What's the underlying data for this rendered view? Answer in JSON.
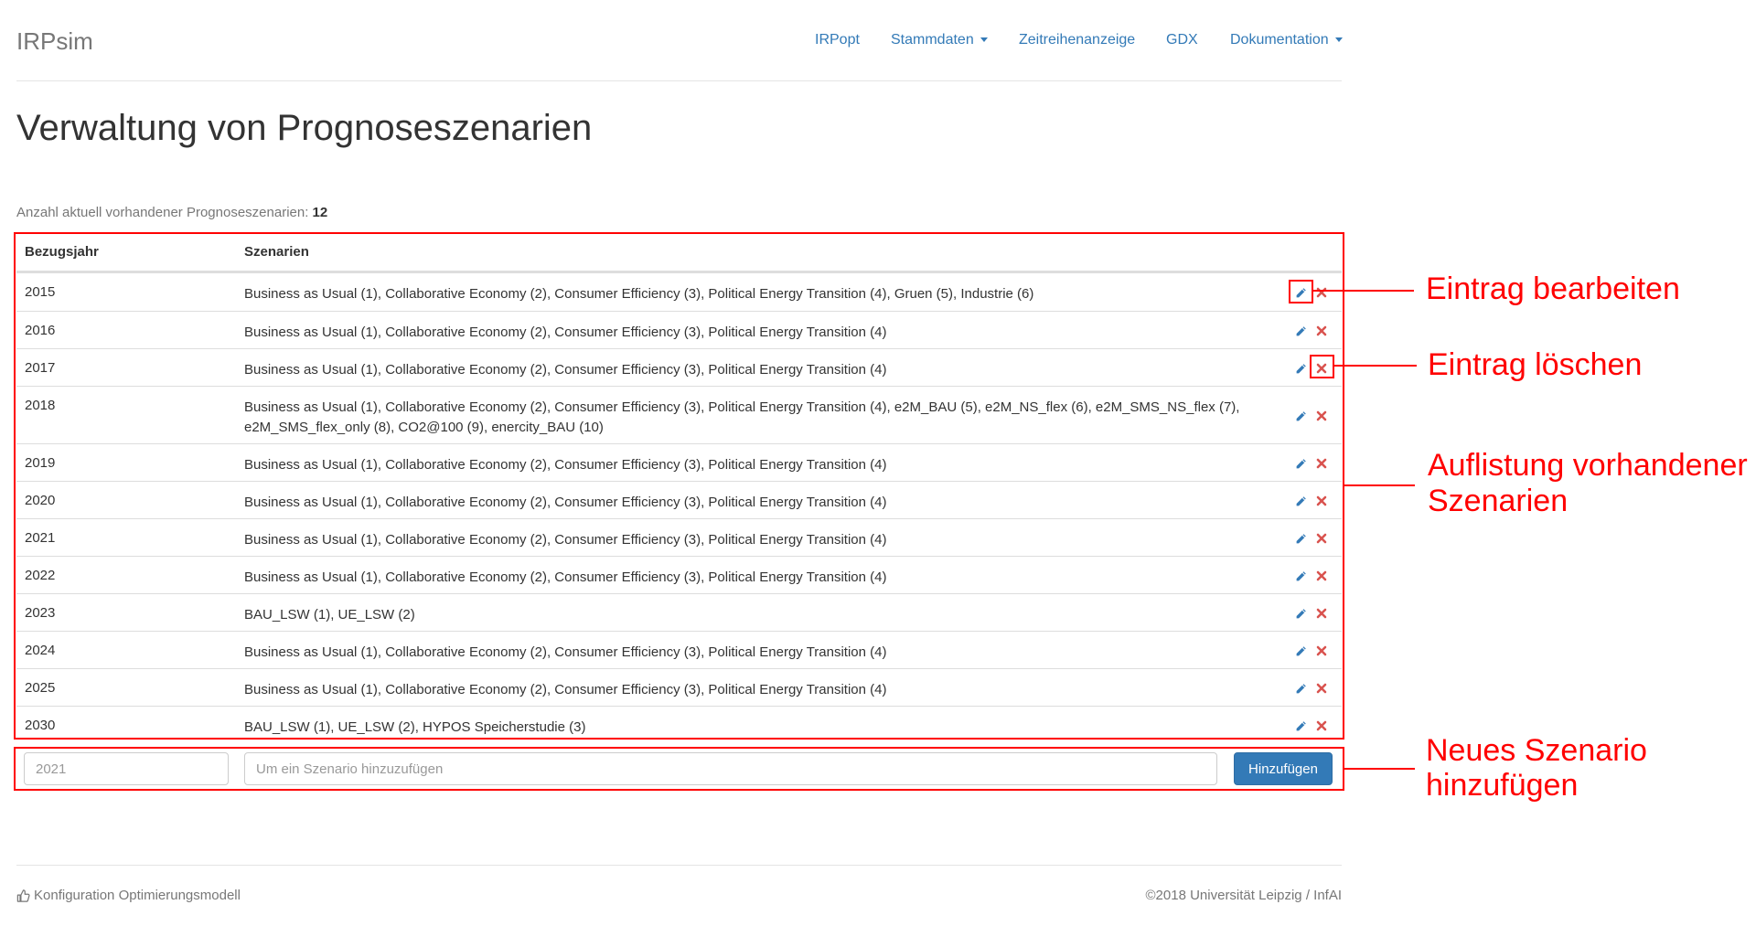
{
  "navbar": {
    "brand": "IRPsim",
    "items": [
      {
        "label": "IRPopt",
        "dropdown": false
      },
      {
        "label": "Stammdaten",
        "dropdown": true
      },
      {
        "label": "Zeitreihenanzeige",
        "dropdown": false
      },
      {
        "label": "GDX",
        "dropdown": false
      },
      {
        "label": "Dokumentation",
        "dropdown": true
      }
    ]
  },
  "page": {
    "title": "Verwaltung von Prognoseszenarien",
    "count_label": "Anzahl aktuell vorhandener Prognoseszenarien:",
    "count_value": "12"
  },
  "table": {
    "headers": [
      "Bezugsjahr",
      "Szenarien"
    ],
    "rows": [
      {
        "year": "2015",
        "scenarios": "Business as Usual (1), Collaborative Economy (2), Consumer Efficiency (3), Political Energy Transition (4), Gruen (5), Industrie (6)"
      },
      {
        "year": "2016",
        "scenarios": "Business as Usual (1), Collaborative Economy (2), Consumer Efficiency (3), Political Energy Transition (4)"
      },
      {
        "year": "2017",
        "scenarios": "Business as Usual (1), Collaborative Economy (2), Consumer Efficiency (3), Political Energy Transition (4)"
      },
      {
        "year": "2018",
        "scenarios": "Business as Usual (1), Collaborative Economy (2), Consumer Efficiency (3), Political Energy Transition (4), e2M_BAU (5), e2M_NS_flex (6), e2M_SMS_NS_flex (7), e2M_SMS_flex_only (8), CO2@100 (9), enercity_BAU (10)"
      },
      {
        "year": "2019",
        "scenarios": "Business as Usual (1), Collaborative Economy (2), Consumer Efficiency (3), Political Energy Transition (4)"
      },
      {
        "year": "2020",
        "scenarios": "Business as Usual (1), Collaborative Economy (2), Consumer Efficiency (3), Political Energy Transition (4)"
      },
      {
        "year": "2021",
        "scenarios": "Business as Usual (1), Collaborative Economy (2), Consumer Efficiency (3), Political Energy Transition (4)"
      },
      {
        "year": "2022",
        "scenarios": "Business as Usual (1), Collaborative Economy (2), Consumer Efficiency (3), Political Energy Transition (4)"
      },
      {
        "year": "2023",
        "scenarios": "BAU_LSW (1), UE_LSW (2)"
      },
      {
        "year": "2024",
        "scenarios": "Business as Usual (1), Collaborative Economy (2), Consumer Efficiency (3), Political Energy Transition (4)"
      },
      {
        "year": "2025",
        "scenarios": "Business as Usual (1), Collaborative Economy (2), Consumer Efficiency (3), Political Energy Transition (4)"
      },
      {
        "year": "2030",
        "scenarios": "BAU_LSW (1), UE_LSW (2), HYPOS Speicherstudie (3)"
      }
    ]
  },
  "form": {
    "year_placeholder": "2021",
    "scenario_placeholder": "Um ein Szenario hinzuzufügen",
    "submit_label": "Hinzufügen"
  },
  "annotations": {
    "edit": "Eintrag bearbeiten",
    "delete": "Eintrag löschen",
    "list_line1": "Auflistung vorhandener",
    "list_line2": "Szenarien",
    "add_line1": "Neues Szenario",
    "add_line2": "hinzufügen"
  },
  "footer": {
    "left_label": "Konfiguration Optimierungsmodell",
    "right_label": "©2018 Universität Leipzig / InfAI"
  },
  "colors": {
    "link": "#337ab7",
    "delete": "#d9534f",
    "annotation": "#ff0000"
  },
  "icons": {
    "edit": "pencil-icon",
    "delete": "close-icon",
    "footer": "thumbs-up-icon"
  }
}
